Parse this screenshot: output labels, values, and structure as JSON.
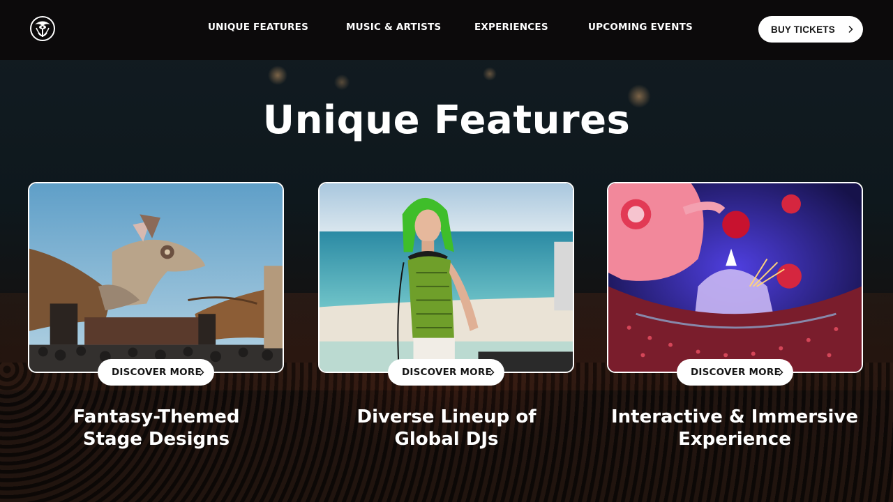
{
  "header": {
    "logo_icon": "tomorrowland-emblem-icon",
    "nav": [
      {
        "label": "UNIQUE FEATURES"
      },
      {
        "label": "MUSIC & ARTISTS"
      },
      {
        "label": "EXPERIENCES"
      },
      {
        "label": "UPCOMING EVENTS"
      }
    ],
    "cta_label": "BUY TICKETS"
  },
  "main": {
    "title": "Unique Features",
    "cards": [
      {
        "image": "dragon-stage-photo",
        "button_label": "DISCOVER MORE",
        "title_line1": "Fantasy-Themed",
        "title_line2": "Stage Designs"
      },
      {
        "image": "green-haired-dj-photo",
        "button_label": "DISCOVER MORE",
        "title_line1": "Diverse Lineup of",
        "title_line2": "Global DJs"
      },
      {
        "image": "immersive-crowd-stage-photo",
        "button_label": "DISCOVER MORE",
        "title_line1": "Interactive & Immersive",
        "title_line2": "Experience"
      }
    ]
  },
  "colors": {
    "header_bg": "#0c0a0b",
    "button_bg": "#ffffff",
    "button_text": "#151515",
    "text": "#ffffff"
  }
}
